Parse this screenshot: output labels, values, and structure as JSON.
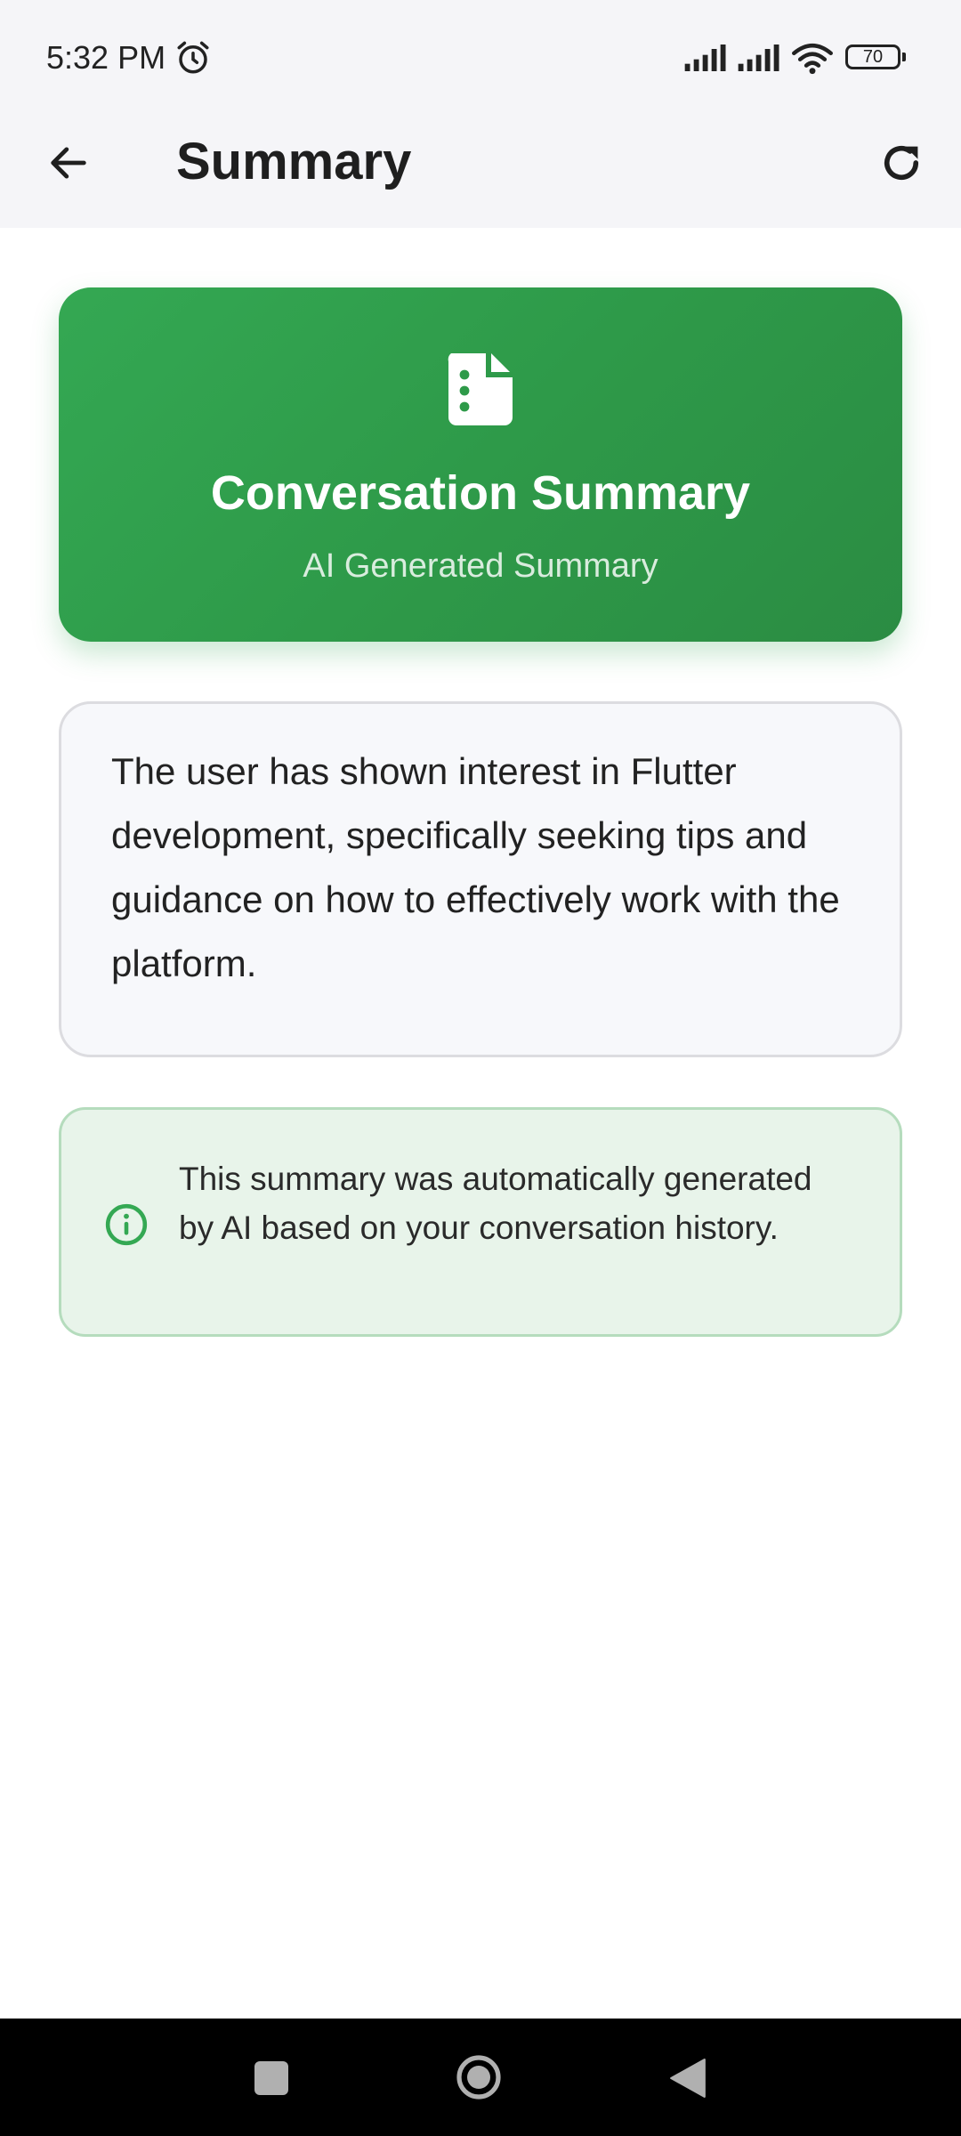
{
  "status_bar": {
    "time": "5:32 PM",
    "battery": "70",
    "icons": [
      "alarm-icon",
      "signal-icon",
      "signal-icon",
      "wifi-icon",
      "battery-icon"
    ]
  },
  "app_bar": {
    "title": "Summary",
    "back_icon": "arrow-left-icon",
    "refresh_icon": "refresh-icon"
  },
  "header_card": {
    "icon": "document-icon",
    "title": "Conversation Summary",
    "subtitle": "AI Generated Summary",
    "color": "#34a853"
  },
  "summary": {
    "text": "The user has shown interest in Flutter development, specifically seeking tips and guidance on how to effectively work with the platform."
  },
  "info_note": {
    "icon": "info-icon",
    "text": "This summary was automatically generated by AI based on your conversation history.",
    "background": "#e8f4ea",
    "accent": "#34a853"
  },
  "nav_bar": {
    "icons": [
      "recents-icon",
      "home-icon",
      "back-icon"
    ]
  }
}
